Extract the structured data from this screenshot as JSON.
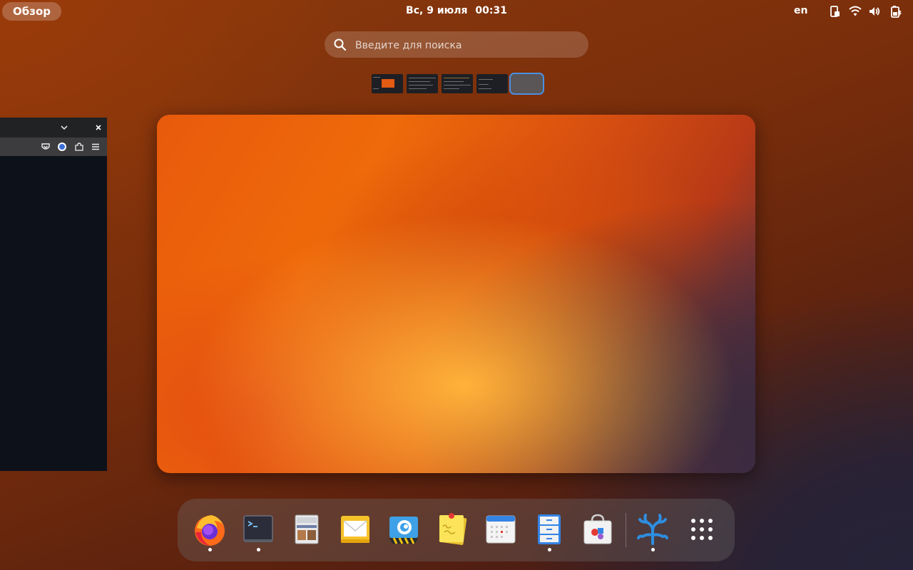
{
  "topbar": {
    "activities_label": "Обзор",
    "clock_day": "Вс, 9 июля",
    "clock_time": "00:31",
    "keyboard_layout": "en",
    "tray_icons": [
      "screen-rotation-icon",
      "wifi-icon",
      "volume-icon",
      "battery-charging-icon"
    ]
  },
  "search": {
    "placeholder": "Введите для поиска",
    "value": ""
  },
  "workspaces": {
    "count": 5,
    "active_index": 4
  },
  "side_window": {
    "titlebar_icons": [
      "chevron-down-icon",
      "close-icon"
    ],
    "toolbar_icons": [
      "pocket-icon",
      "account-icon",
      "extensions-icon",
      "hamburger-menu-icon"
    ]
  },
  "dash": {
    "apps": [
      {
        "name": "firefox-icon",
        "running": true
      },
      {
        "name": "terminal-icon",
        "running": true
      },
      {
        "name": "image-viewer-icon",
        "running": false
      },
      {
        "name": "mail-icon",
        "running": false
      },
      {
        "name": "remote-desktop-icon",
        "running": false
      },
      {
        "name": "sticky-notes-icon",
        "running": false
      },
      {
        "name": "calendar-icon",
        "running": false
      },
      {
        "name": "files-cabinet-icon",
        "running": true
      },
      {
        "name": "software-store-icon",
        "running": false
      },
      {
        "name": "vscodium-icon",
        "running": true
      },
      {
        "name": "app-grid-icon",
        "running": false
      }
    ]
  },
  "colors": {
    "accent": "#4a90e2",
    "panel_bg": "#7a2e0b"
  }
}
